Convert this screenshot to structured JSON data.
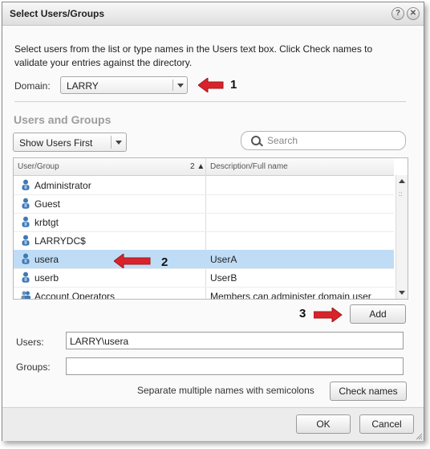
{
  "dialog": {
    "title": "Select Users/Groups",
    "help_icon": "help-icon",
    "close_icon": "close-icon"
  },
  "instructions": "Select users from the list or type names in the Users text box. Click Check names to validate your entries against the directory.",
  "domain": {
    "label": "Domain:",
    "value": "LARRY"
  },
  "callouts": [
    "1",
    "2",
    "3"
  ],
  "section_title": "Users and Groups",
  "filter": {
    "value": "Show Users First"
  },
  "search": {
    "placeholder": "Search"
  },
  "grid": {
    "columns": [
      "User/Group",
      "Description/Full name"
    ],
    "sort_indicator": "2 ▲",
    "rows": [
      {
        "name": "Administrator",
        "description": "",
        "icon": "user-icon",
        "selected": false
      },
      {
        "name": "Guest",
        "description": "",
        "icon": "user-icon",
        "selected": false
      },
      {
        "name": "krbtgt",
        "description": "",
        "icon": "user-icon",
        "selected": false
      },
      {
        "name": "LARRYDC$",
        "description": "",
        "icon": "user-icon",
        "selected": false
      },
      {
        "name": "usera",
        "description": "UserA",
        "icon": "user-icon",
        "selected": true
      },
      {
        "name": "userb",
        "description": "UserB",
        "icon": "user-icon",
        "selected": false
      },
      {
        "name": "Account Operators",
        "description": "Members can administer domain user",
        "icon": "group-icon",
        "selected": false
      }
    ]
  },
  "add_label": "Add",
  "users": {
    "label": "Users:",
    "value": "LARRY\\usera"
  },
  "groups": {
    "label": "Groups:",
    "value": ""
  },
  "hint": "Separate multiple names with semicolons",
  "check_names_label": "Check names",
  "ok_label": "OK",
  "cancel_label": "Cancel",
  "colors": {
    "selected_row": "#bfdcf6",
    "arrow": "#d9232b",
    "section_title": "#9d9d9d"
  }
}
